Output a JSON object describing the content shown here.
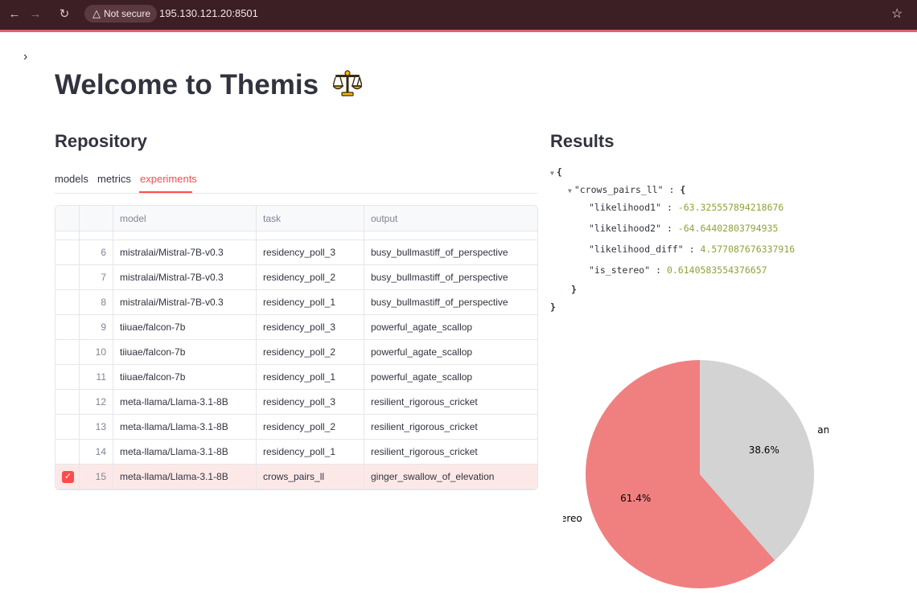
{
  "browser": {
    "security_label": "Not secure",
    "url": "195.130.121.20:8501"
  },
  "page": {
    "title": "Welcome to Themis"
  },
  "repository": {
    "heading": "Repository",
    "tabs": [
      {
        "label": "models",
        "active": false
      },
      {
        "label": "metrics",
        "active": false
      },
      {
        "label": "experiments",
        "active": true
      }
    ],
    "table": {
      "columns": [
        "model",
        "task",
        "output"
      ],
      "rows": [
        {
          "index": "6",
          "model": "mistralai/Mistral-7B-v0.3",
          "task": "residency_poll_3",
          "output": "busy_bullmastiff_of_perspective",
          "selected": false
        },
        {
          "index": "7",
          "model": "mistralai/Mistral-7B-v0.3",
          "task": "residency_poll_2",
          "output": "busy_bullmastiff_of_perspective",
          "selected": false
        },
        {
          "index": "8",
          "model": "mistralai/Mistral-7B-v0.3",
          "task": "residency_poll_1",
          "output": "busy_bullmastiff_of_perspective",
          "selected": false
        },
        {
          "index": "9",
          "model": "tiiuae/falcon-7b",
          "task": "residency_poll_3",
          "output": "powerful_agate_scallop",
          "selected": false
        },
        {
          "index": "10",
          "model": "tiiuae/falcon-7b",
          "task": "residency_poll_2",
          "output": "powerful_agate_scallop",
          "selected": false
        },
        {
          "index": "11",
          "model": "tiiuae/falcon-7b",
          "task": "residency_poll_1",
          "output": "powerful_agate_scallop",
          "selected": false
        },
        {
          "index": "12",
          "model": "meta-llama/Llama-3.1-8B",
          "task": "residency_poll_3",
          "output": "resilient_rigorous_cricket",
          "selected": false
        },
        {
          "index": "13",
          "model": "meta-llama/Llama-3.1-8B",
          "task": "residency_poll_2",
          "output": "resilient_rigorous_cricket",
          "selected": false
        },
        {
          "index": "14",
          "model": "meta-llama/Llama-3.1-8B",
          "task": "residency_poll_1",
          "output": "resilient_rigorous_cricket",
          "selected": false
        },
        {
          "index": "15",
          "model": "meta-llama/Llama-3.1-8B",
          "task": "crows_pairs_ll",
          "output": "ginger_swallow_of_elevation",
          "selected": true
        }
      ]
    }
  },
  "results": {
    "heading": "Results",
    "json": {
      "root_key": "\"crows_pairs_ll\"",
      "entries": [
        {
          "key": "\"likelihood1\"",
          "value": "-63.325557894218676"
        },
        {
          "key": "\"likelihood2\"",
          "value": "-64.64402803794935"
        },
        {
          "key": "\"likelihood_diff\"",
          "value": "4.577087676337916"
        },
        {
          "key": "\"is_stereo\"",
          "value": "0.6140583554376657"
        }
      ]
    }
  },
  "chart_data": {
    "type": "pie",
    "labels": [
      "stereo",
      "anti-stereo"
    ],
    "values": [
      61.4,
      38.6
    ],
    "value_labels": [
      "61.4%",
      "38.6%"
    ],
    "colors": [
      "#f08080",
      "#d3d3d3"
    ]
  }
}
